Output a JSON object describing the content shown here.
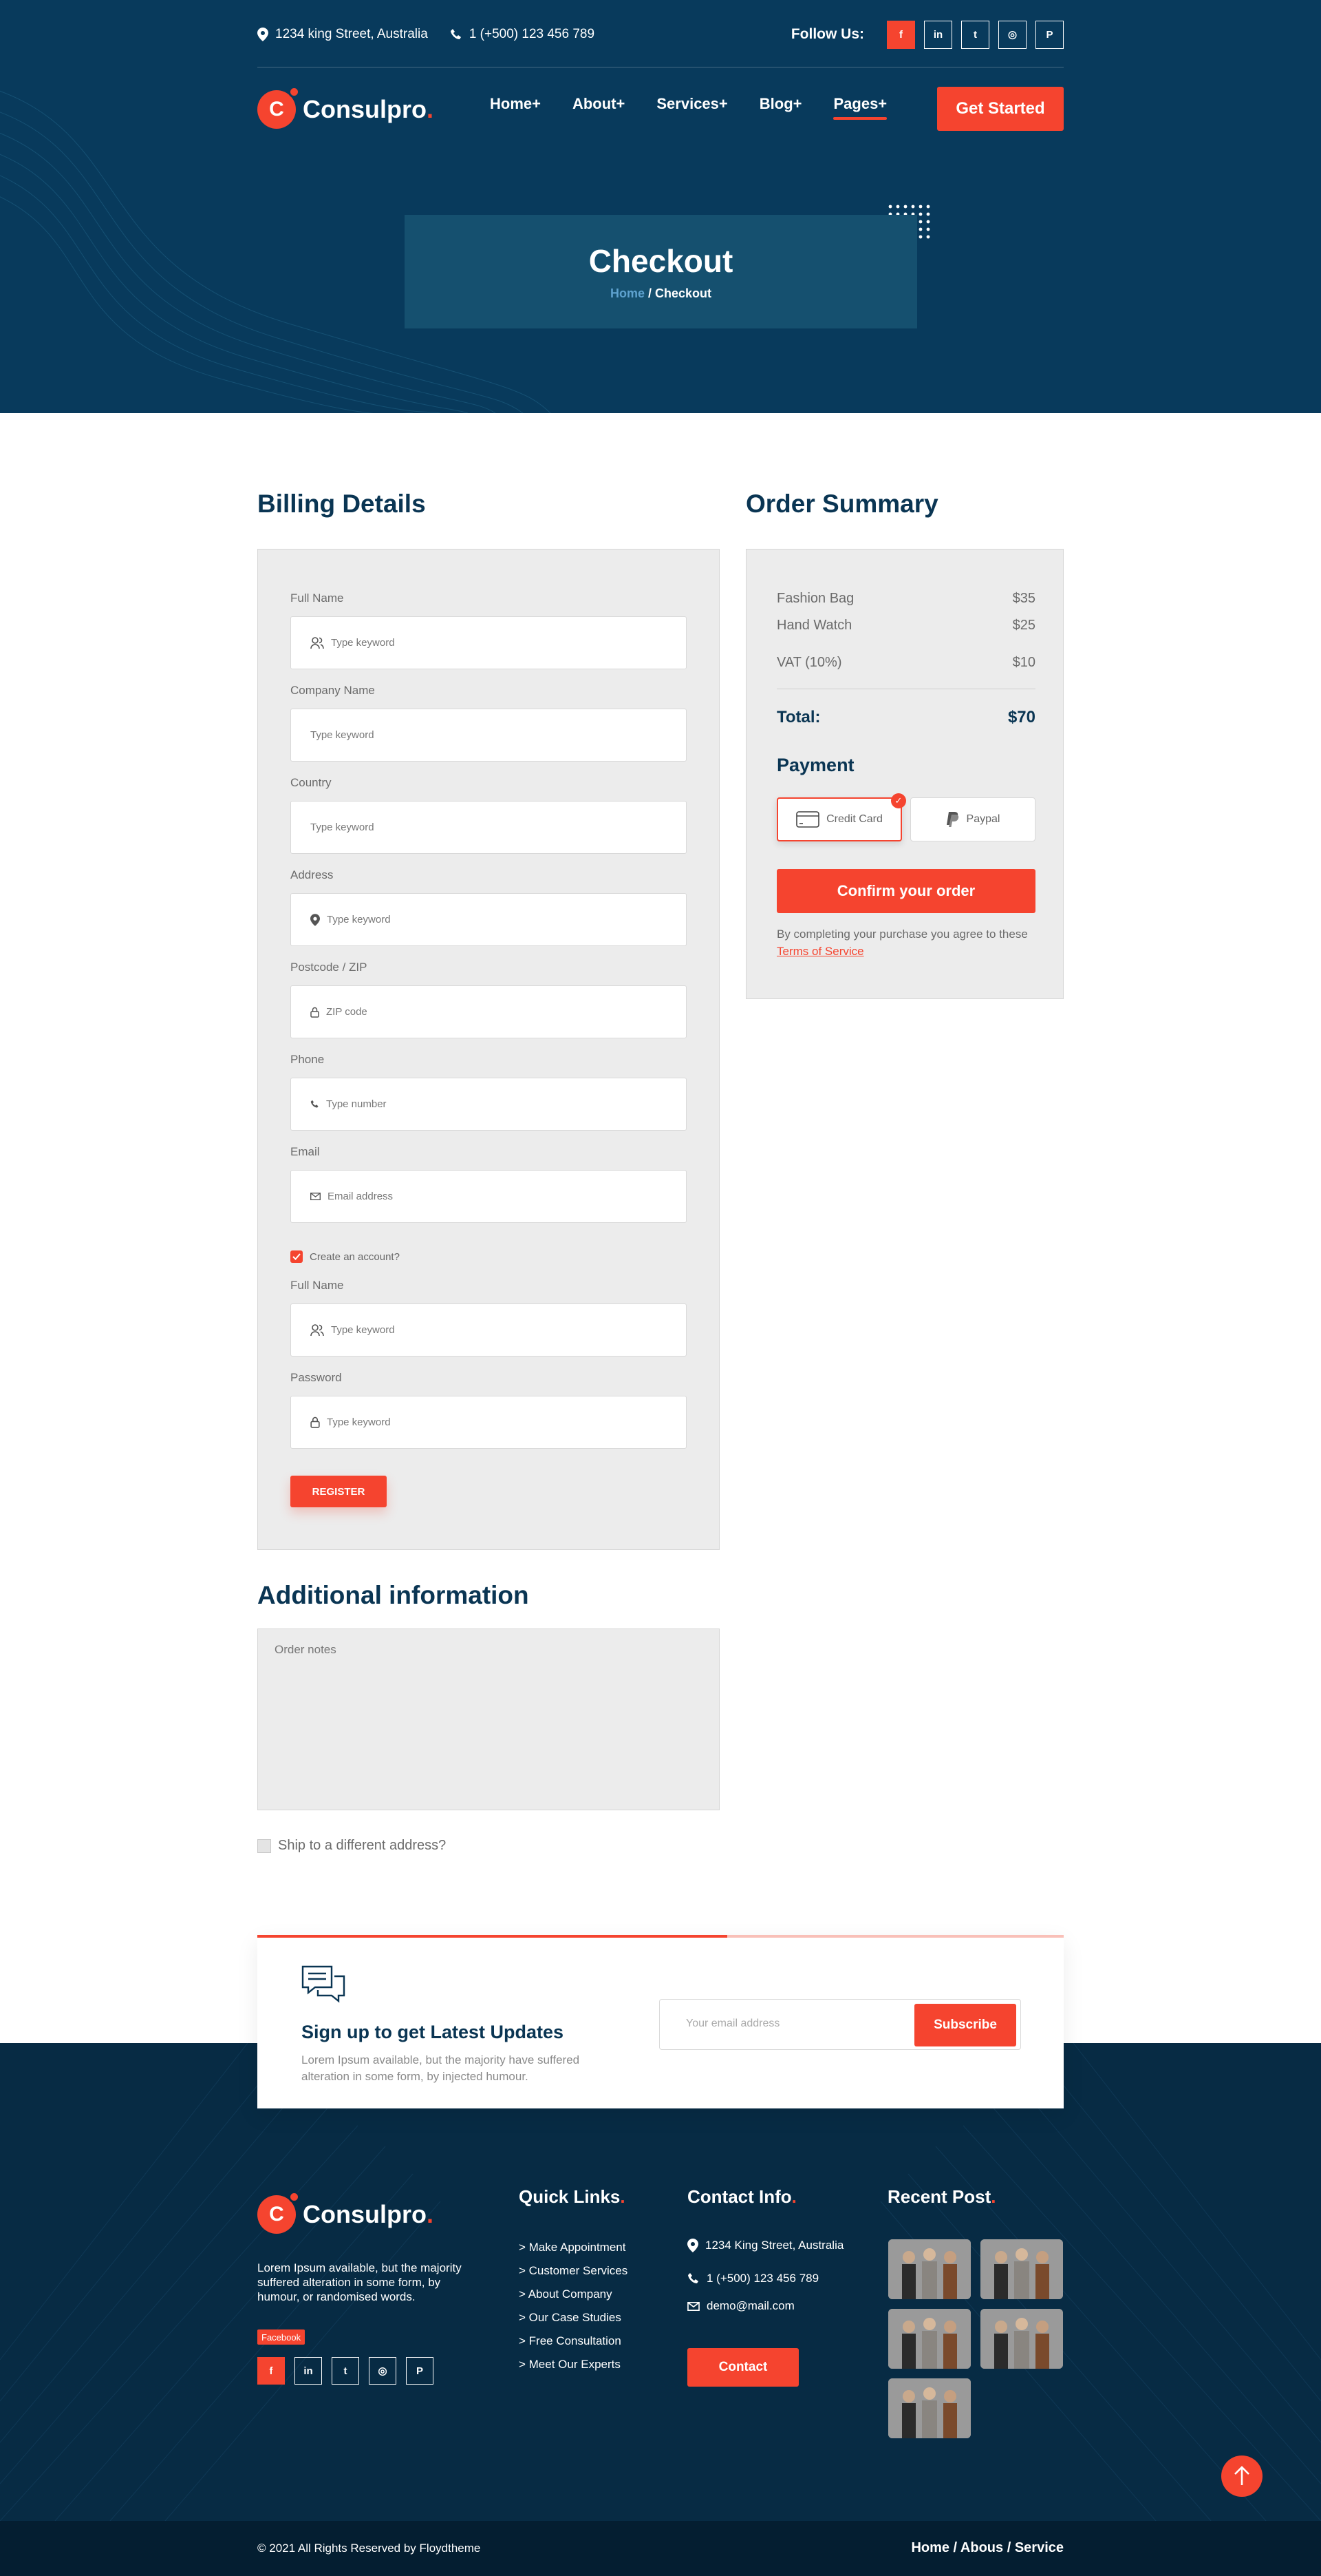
{
  "topbar": {
    "address": "1234 king Street, Australia",
    "phone": "1 (+500) 123 456 789",
    "follow_label": "Follow Us:",
    "socials": [
      {
        "icon": "facebook-icon",
        "glyph": "f"
      },
      {
        "icon": "linkedin-icon",
        "glyph": "in"
      },
      {
        "icon": "twitter-icon",
        "glyph": "t"
      },
      {
        "icon": "instagram-icon",
        "glyph": "◎"
      },
      {
        "icon": "pinterest-icon",
        "glyph": "P"
      }
    ]
  },
  "brand": {
    "mark": "C",
    "name": "Consulpro",
    "dot": "."
  },
  "nav": {
    "items": [
      "Home+",
      "About+",
      "Services+",
      "Blog+",
      "Pages+"
    ],
    "active": "Pages+",
    "cta": "Get Started"
  },
  "page_title": {
    "title": "Checkout",
    "home": "Home",
    "separator": "/",
    "current": "Checkout"
  },
  "billing": {
    "heading": "Billing Details",
    "fields": [
      {
        "label": "Full Name",
        "placeholder": "Type keyword",
        "icon": "user-icon"
      },
      {
        "label": "Company Name",
        "placeholder": "Type keyword",
        "icon": ""
      },
      {
        "label": "Country",
        "placeholder": "Type keyword",
        "icon": ""
      },
      {
        "label": "Address",
        "placeholder": "Type keyword",
        "icon": "map-pin-icon"
      },
      {
        "label": "Postcode / ZIP",
        "placeholder": "ZIP code",
        "icon": "lock-icon"
      },
      {
        "label": "Phone",
        "placeholder": "Type number",
        "icon": "phone-icon"
      },
      {
        "label": "Email",
        "placeholder": "Email address",
        "icon": "mail-icon"
      }
    ],
    "create_account": {
      "label": "Create an account?",
      "checked": true
    },
    "account_fields": [
      {
        "label": "Full Name",
        "placeholder": "Type keyword",
        "icon": "user-icon"
      },
      {
        "label": "Password",
        "placeholder": "Type keyword",
        "icon": "lock-icon"
      }
    ],
    "register": "REGISTER"
  },
  "additional": {
    "heading": "Additional information",
    "notes_placeholder": "Order notes",
    "ship_label": "Ship to a different address?"
  },
  "order": {
    "heading": "Order Summary",
    "items": [
      {
        "name": "Fashion Bag",
        "price": "$35"
      },
      {
        "name": "Hand Watch",
        "price": "$25"
      }
    ],
    "vat": {
      "name": "VAT (10%)",
      "price": "$10"
    },
    "total": {
      "label": "Total:",
      "value": "$70"
    },
    "payment_heading": "Payment",
    "methods": [
      "Credit Card",
      "Paypal"
    ],
    "selected_method": "Credit Card",
    "confirm": "Confirm your order",
    "terms_text": "By completing your purchase you agree to these",
    "terms_link": "Terms of Service"
  },
  "newsletter": {
    "title": "Sign up to get Latest Updates",
    "text": "Lorem Ipsum available, but the majority have suffered alteration in some form, by injected humour.",
    "placeholder": "Your email address",
    "button": "Subscribe"
  },
  "footer": {
    "about": "Lorem Ipsum available, but the majority suffered alteration in some form, by humour, or randomised words.",
    "facebook_badge": "Facebook",
    "quick_links_title": "Quick Links",
    "quick_links": [
      "> Make Appointment",
      "> Customer Services",
      "> About Company",
      "> Our Case Studies",
      "> Free Consultation",
      "> Meet Our Experts"
    ],
    "contact_title": "Contact Info",
    "contact": {
      "address": "1234 King Street, Australia",
      "phone": "1 (+500) 123 456 789",
      "email": "demo@mail.com"
    },
    "contact_button": "Contact",
    "recent_title": "Recent Post",
    "copyright": "© 2021 All Rights Reserved by Floydtheme",
    "bottom_links": "Home / Abous / Service"
  },
  "colors": {
    "accent": "#f5442f",
    "navy": "#083a5c",
    "footer": "#072b44"
  }
}
